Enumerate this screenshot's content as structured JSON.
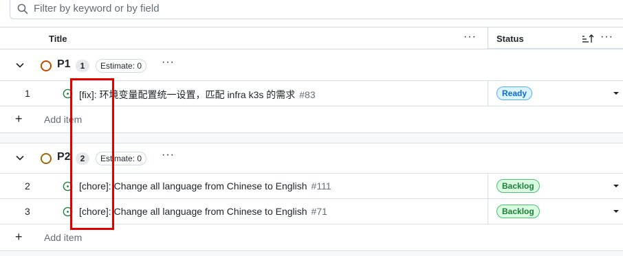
{
  "filter": {
    "placeholder": "Filter by keyword or by field",
    "value": ""
  },
  "table_header": {
    "title_label": "Title",
    "status_label": "Status",
    "title_menu_icon": "kebab-horizontal-icon",
    "status_sort_icon": "sort-desc-icon",
    "status_menu_icon": "kebab-horizontal-icon"
  },
  "groups": [
    {
      "name": "P1",
      "count": "1",
      "estimate": "Estimate: 0",
      "color": "#bc4c00",
      "items": [
        {
          "num": "1",
          "title": "[fix]: 环境变量配置统一设置，匹配 infra k3s 的需求",
          "number": "#83",
          "status": "Ready"
        }
      ],
      "add_item_label": "Add item"
    },
    {
      "name": "P2",
      "count": "2",
      "estimate": "Estimate: 0",
      "color": "#9a6700",
      "items": [
        {
          "num": "2",
          "title": "[chore]: Change all language from Chinese to English",
          "number": "#111",
          "status": "Backlog"
        },
        {
          "num": "3",
          "title": "[chore]: Change all language from Chinese to English",
          "number": "#71",
          "status": "Backlog"
        }
      ],
      "add_item_label": "Add item"
    }
  ],
  "status_colors": {
    "Ready": {
      "bg": "#ddf4ff",
      "border": "#54aeff",
      "text": "#0969da"
    },
    "Backlog": {
      "bg": "#dafbe1",
      "border": "#4ac26b",
      "text": "#1a7f37"
    }
  },
  "icons": {
    "search": "search-icon",
    "issue_open": "issue-opened-icon",
    "chevron": "chevron-down-icon",
    "add": "plus-icon",
    "status_dropdown": "triangle-down-icon"
  },
  "annotation": {
    "type": "red-rectangle-highlight",
    "color": "#e00000"
  }
}
